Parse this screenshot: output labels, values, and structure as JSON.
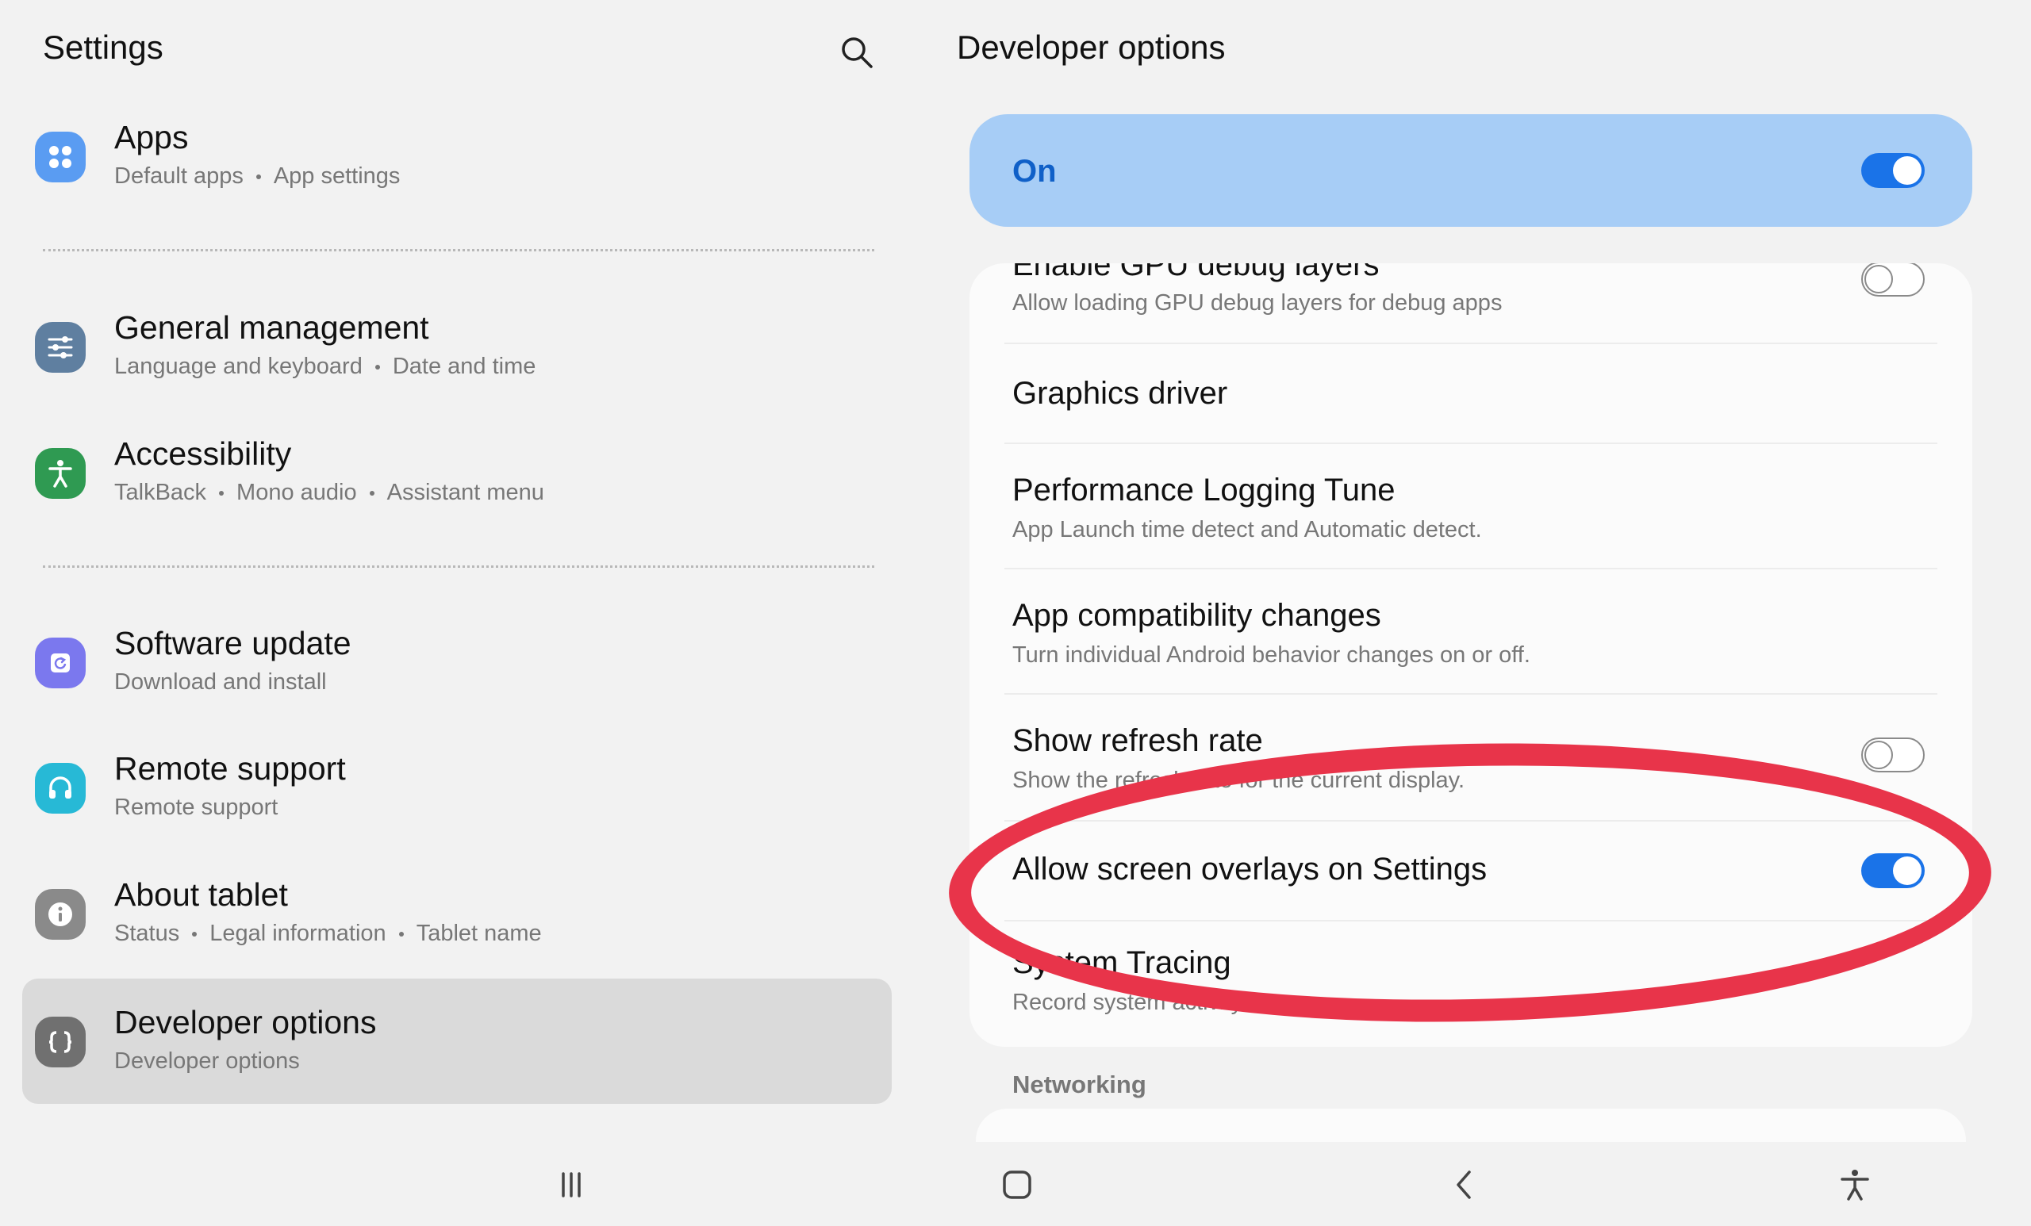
{
  "left_pane": {
    "title": "Settings",
    "search_icon": "search-icon",
    "items": [
      {
        "key": "apps",
        "title": "Apps",
        "subs": [
          "Default apps",
          "App settings"
        ],
        "icon": "apps-grid-icon",
        "color": "#5a9cf2"
      },
      {
        "key": "general",
        "title": "General management",
        "subs": [
          "Language and keyboard",
          "Date and time"
        ],
        "icon": "sliders-icon",
        "color": "#5f7fa0"
      },
      {
        "key": "accessibility",
        "title": "Accessibility",
        "subs": [
          "TalkBack",
          "Mono audio",
          "Assistant menu"
        ],
        "icon": "accessibility-person-icon",
        "color": "#2f9a52"
      },
      {
        "key": "software",
        "title": "Software update",
        "subs": [
          "Download and install"
        ],
        "icon": "software-update-icon",
        "color": "#7b78ee"
      },
      {
        "key": "remote",
        "title": "Remote support",
        "subs": [
          "Remote support"
        ],
        "icon": "headset-icon",
        "color": "#27b9d6"
      },
      {
        "key": "about",
        "title": "About tablet",
        "subs": [
          "Status",
          "Legal information",
          "Tablet name"
        ],
        "icon": "info-icon",
        "color": "#8a8a8a"
      },
      {
        "key": "developer",
        "title": "Developer options",
        "subs": [
          "Developer options"
        ],
        "icon": "code-braces-icon",
        "color": "#707070",
        "selected": true
      }
    ]
  },
  "right_pane": {
    "title": "Developer options",
    "master_toggle": {
      "label": "On",
      "state": "on"
    },
    "rows": [
      {
        "title": "Enable GPU debug layers",
        "sub": "Allow loading GPU debug layers for debug apps",
        "toggle": "off"
      },
      {
        "title": "Graphics driver",
        "sub": "",
        "toggle": null
      },
      {
        "title": "Performance Logging Tune",
        "sub": "App Launch time detect and Automatic detect.",
        "toggle": null
      },
      {
        "title": "App compatibility changes",
        "sub": "Turn individual Android behavior changes on or off.",
        "toggle": null
      },
      {
        "title": "Show refresh rate",
        "sub": "Show the refresh rate for the current display.",
        "toggle": "off"
      },
      {
        "title": "Allow screen overlays on Settings",
        "sub": "",
        "toggle": "on"
      },
      {
        "title": "System Tracing",
        "sub": "Record system activity",
        "toggle": null
      }
    ],
    "section_label": "Networking"
  },
  "nav_bar": {
    "icons": [
      "recent-apps-icon",
      "home-icon",
      "back-icon",
      "accessibility-shortcut-icon"
    ]
  },
  "colors": {
    "accent": "#1a73e8",
    "on_bar": "#a7cdf6",
    "annotation": "#e8344a",
    "selected_row": "#dadada"
  }
}
